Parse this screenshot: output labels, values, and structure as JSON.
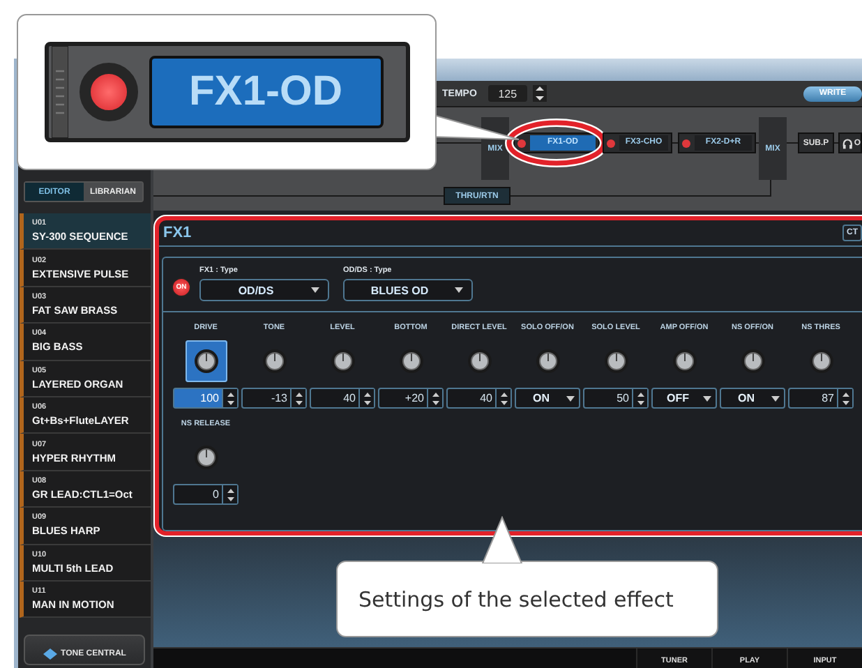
{
  "zoom_callout": {
    "label": "FX1-OD",
    "on": true
  },
  "toolbar": {
    "tempo_label": "TEMPO",
    "tempo_value": "125",
    "write_button": "WRITE"
  },
  "sidebar": {
    "tabs": [
      {
        "label": "EDITOR",
        "selected": true
      },
      {
        "label": "LIBRARIAN",
        "selected": false
      }
    ],
    "patches": [
      {
        "number": "U01",
        "name": "SY-300 SEQUENCE",
        "selected": true
      },
      {
        "number": "U02",
        "name": "EXTENSIVE PULSE",
        "selected": false
      },
      {
        "number": "U03",
        "name": "FAT SAW BRASS",
        "selected": false
      },
      {
        "number": "U04",
        "name": "BIG BASS",
        "selected": false
      },
      {
        "number": "U05",
        "name": "LAYERED ORGAN",
        "selected": false
      },
      {
        "number": "U06",
        "name": "Gt+Bs+FluteLAYER",
        "selected": false
      },
      {
        "number": "U07",
        "name": "HYPER RHYTHM",
        "selected": false
      },
      {
        "number": "U08",
        "name": "GR LEAD:CTL1=Oct",
        "selected": false
      },
      {
        "number": "U09",
        "name": "BLUES HARP",
        "selected": false
      },
      {
        "number": "U10",
        "name": "MULTI 5th LEAD",
        "selected": false
      },
      {
        "number": "U11",
        "name": "MAN IN MOTION",
        "selected": false
      }
    ],
    "tone_central": "TONE CENTRAL"
  },
  "chain": {
    "blocks": [
      {
        "kind": "mix",
        "label": "MIX"
      },
      {
        "kind": "fx",
        "label": "FX1-OD",
        "on": true,
        "selected": true,
        "highlighted": true
      },
      {
        "kind": "fx",
        "label": "FX3-CHO",
        "on": true,
        "selected": false,
        "highlighted": false
      },
      {
        "kind": "fx",
        "label": "FX2-D+R",
        "on": true,
        "selected": false,
        "highlighted": false
      },
      {
        "kind": "mix",
        "label": "MIX"
      },
      {
        "kind": "plain",
        "label": "SUB.P"
      },
      {
        "kind": "output",
        "label": "O"
      }
    ],
    "thru_label": "THRU/RTN"
  },
  "fx_panel": {
    "title": "FX1",
    "ctl_label": "CT",
    "highlighted": true,
    "on_button": {
      "label": "ON",
      "on": true
    },
    "selectors": [
      {
        "label": "FX1 : Type",
        "value": "OD/DS"
      },
      {
        "label": "OD/DS : Type",
        "value": "BLUES OD"
      }
    ],
    "param_rows": [
      {
        "params": [
          {
            "name": "DRIVE",
            "kind": "number",
            "value": "100",
            "selected": true
          },
          {
            "name": "TONE",
            "kind": "number",
            "value": "-13",
            "selected": false
          },
          {
            "name": "LEVEL",
            "kind": "number",
            "value": "40",
            "selected": false
          },
          {
            "name": "BOTTOM",
            "kind": "number",
            "value": "+20",
            "selected": false
          },
          {
            "name": "DIRECT LEVEL",
            "kind": "number",
            "value": "40",
            "selected": false
          },
          {
            "name": "SOLO OFF/ON",
            "kind": "select",
            "value": "ON",
            "selected": false
          },
          {
            "name": "SOLO LEVEL",
            "kind": "number",
            "value": "50",
            "selected": false
          },
          {
            "name": "AMP OFF/ON",
            "kind": "select",
            "value": "OFF",
            "selected": false
          },
          {
            "name": "NS OFF/ON",
            "kind": "select",
            "value": "ON",
            "selected": false
          },
          {
            "name": "NS THRES",
            "kind": "number",
            "value": "87",
            "selected": false
          }
        ]
      },
      {
        "params": [
          {
            "name": "NS RELEASE",
            "kind": "number",
            "value": "0",
            "selected": false
          }
        ]
      }
    ]
  },
  "text_callout": {
    "text": "Settings of the selected effect"
  },
  "bottom_bar": [
    "TUNER",
    "PLAY",
    "INPUT"
  ]
}
